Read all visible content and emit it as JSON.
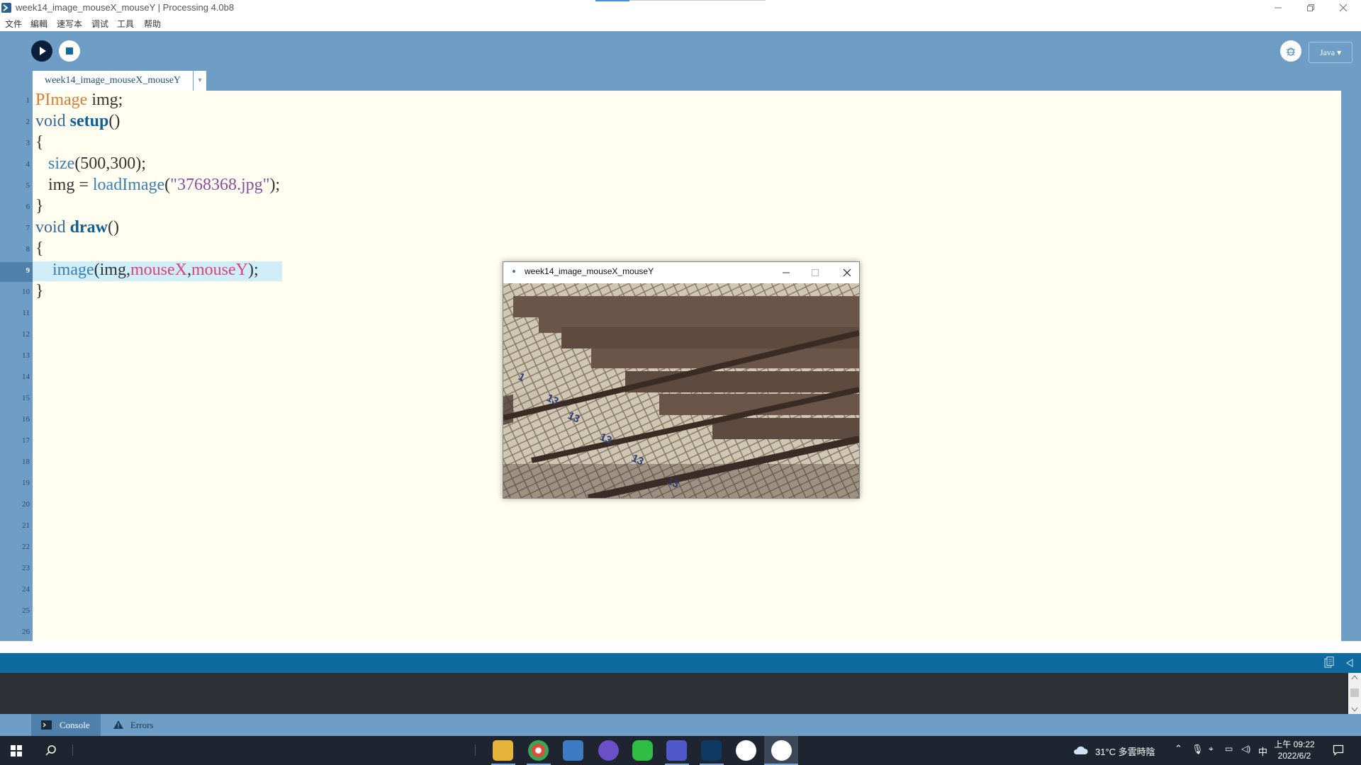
{
  "window": {
    "title": "week14_image_mouseX_mouseY | Processing 4.0b8"
  },
  "menu": [
    "文件",
    "編輯",
    "速写本",
    "调试",
    "工具",
    "帮助"
  ],
  "toolbar": {
    "run_icon": "play-icon",
    "stop_icon": "stop-icon",
    "debug_icon": "debugger-icon",
    "mode": "Java ▾"
  },
  "tabs": {
    "sketch_tab": "week14_image_mouseX_mouseY",
    "menu_arrow": "▾"
  },
  "editor": {
    "line_numbers": [
      "1",
      "2",
      "3",
      "4",
      "5",
      "6",
      "7",
      "8",
      "9",
      "10",
      "11",
      "12",
      "13",
      "14",
      "15",
      "16",
      "17",
      "18",
      "19",
      "20",
      "21",
      "22",
      "23",
      "24",
      "25",
      "26"
    ],
    "active_line": 9,
    "code": {
      "l1_type": "PImage",
      "l1_rest": " img;",
      "l2_kw": "void",
      "l2_fn": "setup",
      "l2_rest": "()",
      "l3": "{",
      "l4_fn": "size",
      "l4_rest": "(500,300);",
      "l5_a": "img = ",
      "l5_fn": "loadImage",
      "l5_b": "(",
      "l5_str": "\"3768368.jpg\"",
      "l5_c": ");",
      "l6": "}",
      "l7_kw": "void",
      "l7_fn": "draw",
      "l7_rest": "()",
      "l8": "{",
      "l9_fn": "image",
      "l9_a": "(img,",
      "l9_mx": "mouseX",
      "l9_b": ",",
      "l9_my": "mouseY",
      "l9_c": ");",
      "l10": "}"
    }
  },
  "console_tabs": {
    "console": "Console",
    "errors": "Errors"
  },
  "sketch_window": {
    "title": "week14_image_mouseX_mouseY"
  },
  "taskbar": {
    "weather": "31°C 多雲時陰",
    "ime": "中",
    "time_prefix": "上午 09:22",
    "date": "2022/6/2"
  },
  "colors": {
    "accent_blue": "#6e9dc6",
    "status_blue": "#0f6aa0",
    "editor_bg": "#fffef0"
  }
}
